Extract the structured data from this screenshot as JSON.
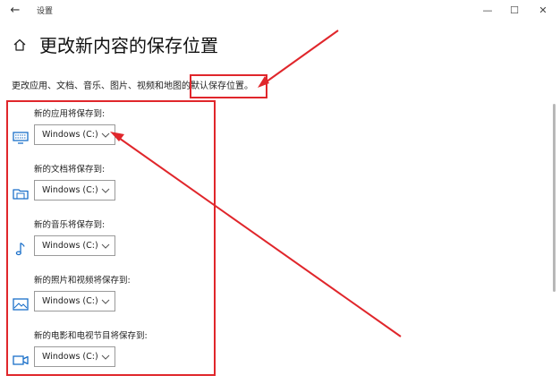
{
  "window": {
    "title": "设置",
    "back_glyph": "←",
    "minimize_glyph": "—",
    "maximize_glyph": "☐",
    "close_glyph": "✕"
  },
  "page": {
    "title": "更改新内容的保存位置",
    "description": "更改应用、文档、音乐、图片、视频和地图的默认保存位置。"
  },
  "sections": [
    {
      "label": "新的应用将保存到:",
      "value": "Windows (C:)",
      "icon": "monitor-icon"
    },
    {
      "label": "新的文档将保存到:",
      "value": "Windows (C:)",
      "icon": "folder-icon"
    },
    {
      "label": "新的音乐将保存到:",
      "value": "Windows (C:)",
      "icon": "music-note-icon"
    },
    {
      "label": "新的照片和视频将保存到:",
      "value": "Windows (C:)",
      "icon": "image-icon"
    },
    {
      "label": "新的电影和电视节目将保存到:",
      "value": "Windows (C:)",
      "icon": "video-camera-icon"
    }
  ],
  "colors": {
    "annotation_red": "#e0262b",
    "icon_blue": "#1a6fc9"
  }
}
